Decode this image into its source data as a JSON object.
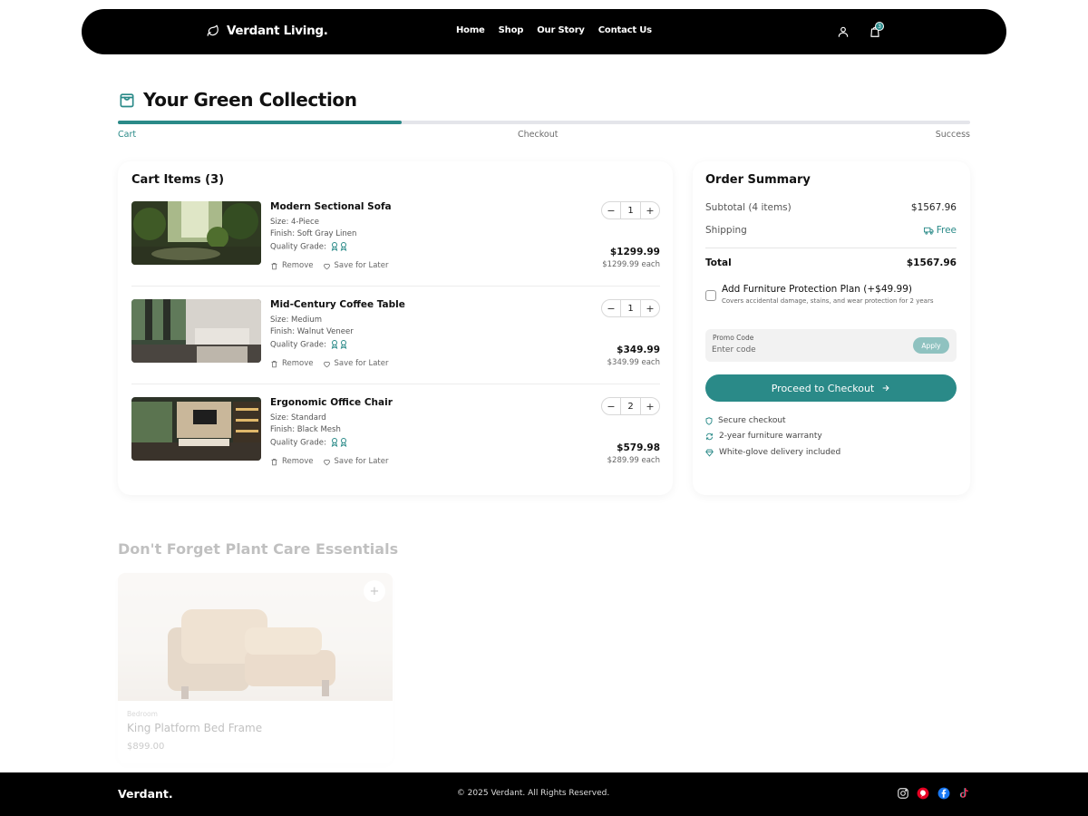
{
  "header": {
    "brand": "Verdant Living.",
    "nav": [
      "Home",
      "Shop",
      "Our Story",
      "Contact Us"
    ],
    "cart_count": "3"
  },
  "page": {
    "title": "Your Green Collection",
    "progress_percent": 33.3,
    "steps": [
      "Cart",
      "Checkout",
      "Success"
    ]
  },
  "cart": {
    "title": "Cart Items (3)",
    "items": [
      {
        "name": "Modern Sectional Sofa",
        "size": "Size: 4-Piece",
        "finish": "Finish: Soft Gray Linen",
        "grade_label": "Quality Grade:",
        "qty": "1",
        "total": "$1299.99",
        "each": "$1299.99 each",
        "remove": "Remove",
        "save": "Save for Later"
      },
      {
        "name": "Mid-Century Coffee Table",
        "size": "Size: Medium",
        "finish": "Finish: Walnut Veneer",
        "grade_label": "Quality Grade:",
        "qty": "1",
        "total": "$349.99",
        "each": "$349.99 each",
        "remove": "Remove",
        "save": "Save for Later"
      },
      {
        "name": "Ergonomic Office Chair",
        "size": "Size: Standard",
        "finish": "Finish: Black Mesh",
        "grade_label": "Quality Grade:",
        "qty": "2",
        "total": "$579.98",
        "each": "$289.99 each",
        "remove": "Remove",
        "save": "Save for Later"
      }
    ]
  },
  "summary": {
    "title": "Order Summary",
    "subtotal_label": "Subtotal (4 items)",
    "subtotal_value": "$1567.96",
    "shipping_label": "Shipping",
    "shipping_value": "Free",
    "total_label": "Total",
    "total_value": "$1567.96",
    "plan_title": "Add Furniture Protection Plan (+$49.99)",
    "plan_desc": "Covers accidental damage, stains, and wear protection for 2 years",
    "promo_label": "Promo Code",
    "promo_placeholder": "Enter code",
    "apply_label": "Apply",
    "checkout_label": "Proceed to Checkout",
    "trust": [
      "Secure checkout",
      "2-year furniture warranty",
      "White-glove delivery included"
    ]
  },
  "recommendations": {
    "title": "Don't Forget Plant Care Essentials",
    "card": {
      "category": "Bedroom",
      "name": "King Platform Bed Frame",
      "price": "$899.00",
      "add_label": "+"
    }
  },
  "footer": {
    "brand": "Verdant.",
    "copyright": "© 2025 Verdant. All Rights Reserved."
  },
  "colors": {
    "accent": "#2a8a88",
    "header_bg": "#000000",
    "pinterest": "#e60023",
    "facebook": "#1877f2"
  }
}
